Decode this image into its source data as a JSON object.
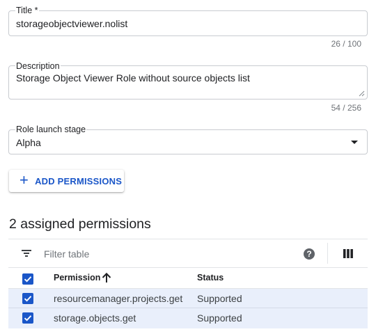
{
  "title_field": {
    "label": "Title *",
    "value": "storageobjectviewer.nolist",
    "counter": "26 / 100"
  },
  "description_field": {
    "label": "Description",
    "value": "Storage Object Viewer Role without source objects list",
    "counter": "54 / 256"
  },
  "stage_field": {
    "label": "Role launch stage",
    "value": "Alpha"
  },
  "add_permissions_button": {
    "icon": "plus-icon",
    "label": "ADD PERMISSIONS"
  },
  "permissions": {
    "heading": "2 assigned permissions",
    "filter_placeholder": "Filter table",
    "columns": {
      "permission": "Permission",
      "status": "Status"
    },
    "rows": [
      {
        "permission": "resourcemanager.projects.get",
        "status": "Supported",
        "checked": true
      },
      {
        "permission": "storage.objects.get",
        "status": "Supported",
        "checked": true
      }
    ]
  },
  "colors": {
    "accent": "#1a56c8",
    "row_selected": "#e9effb"
  }
}
